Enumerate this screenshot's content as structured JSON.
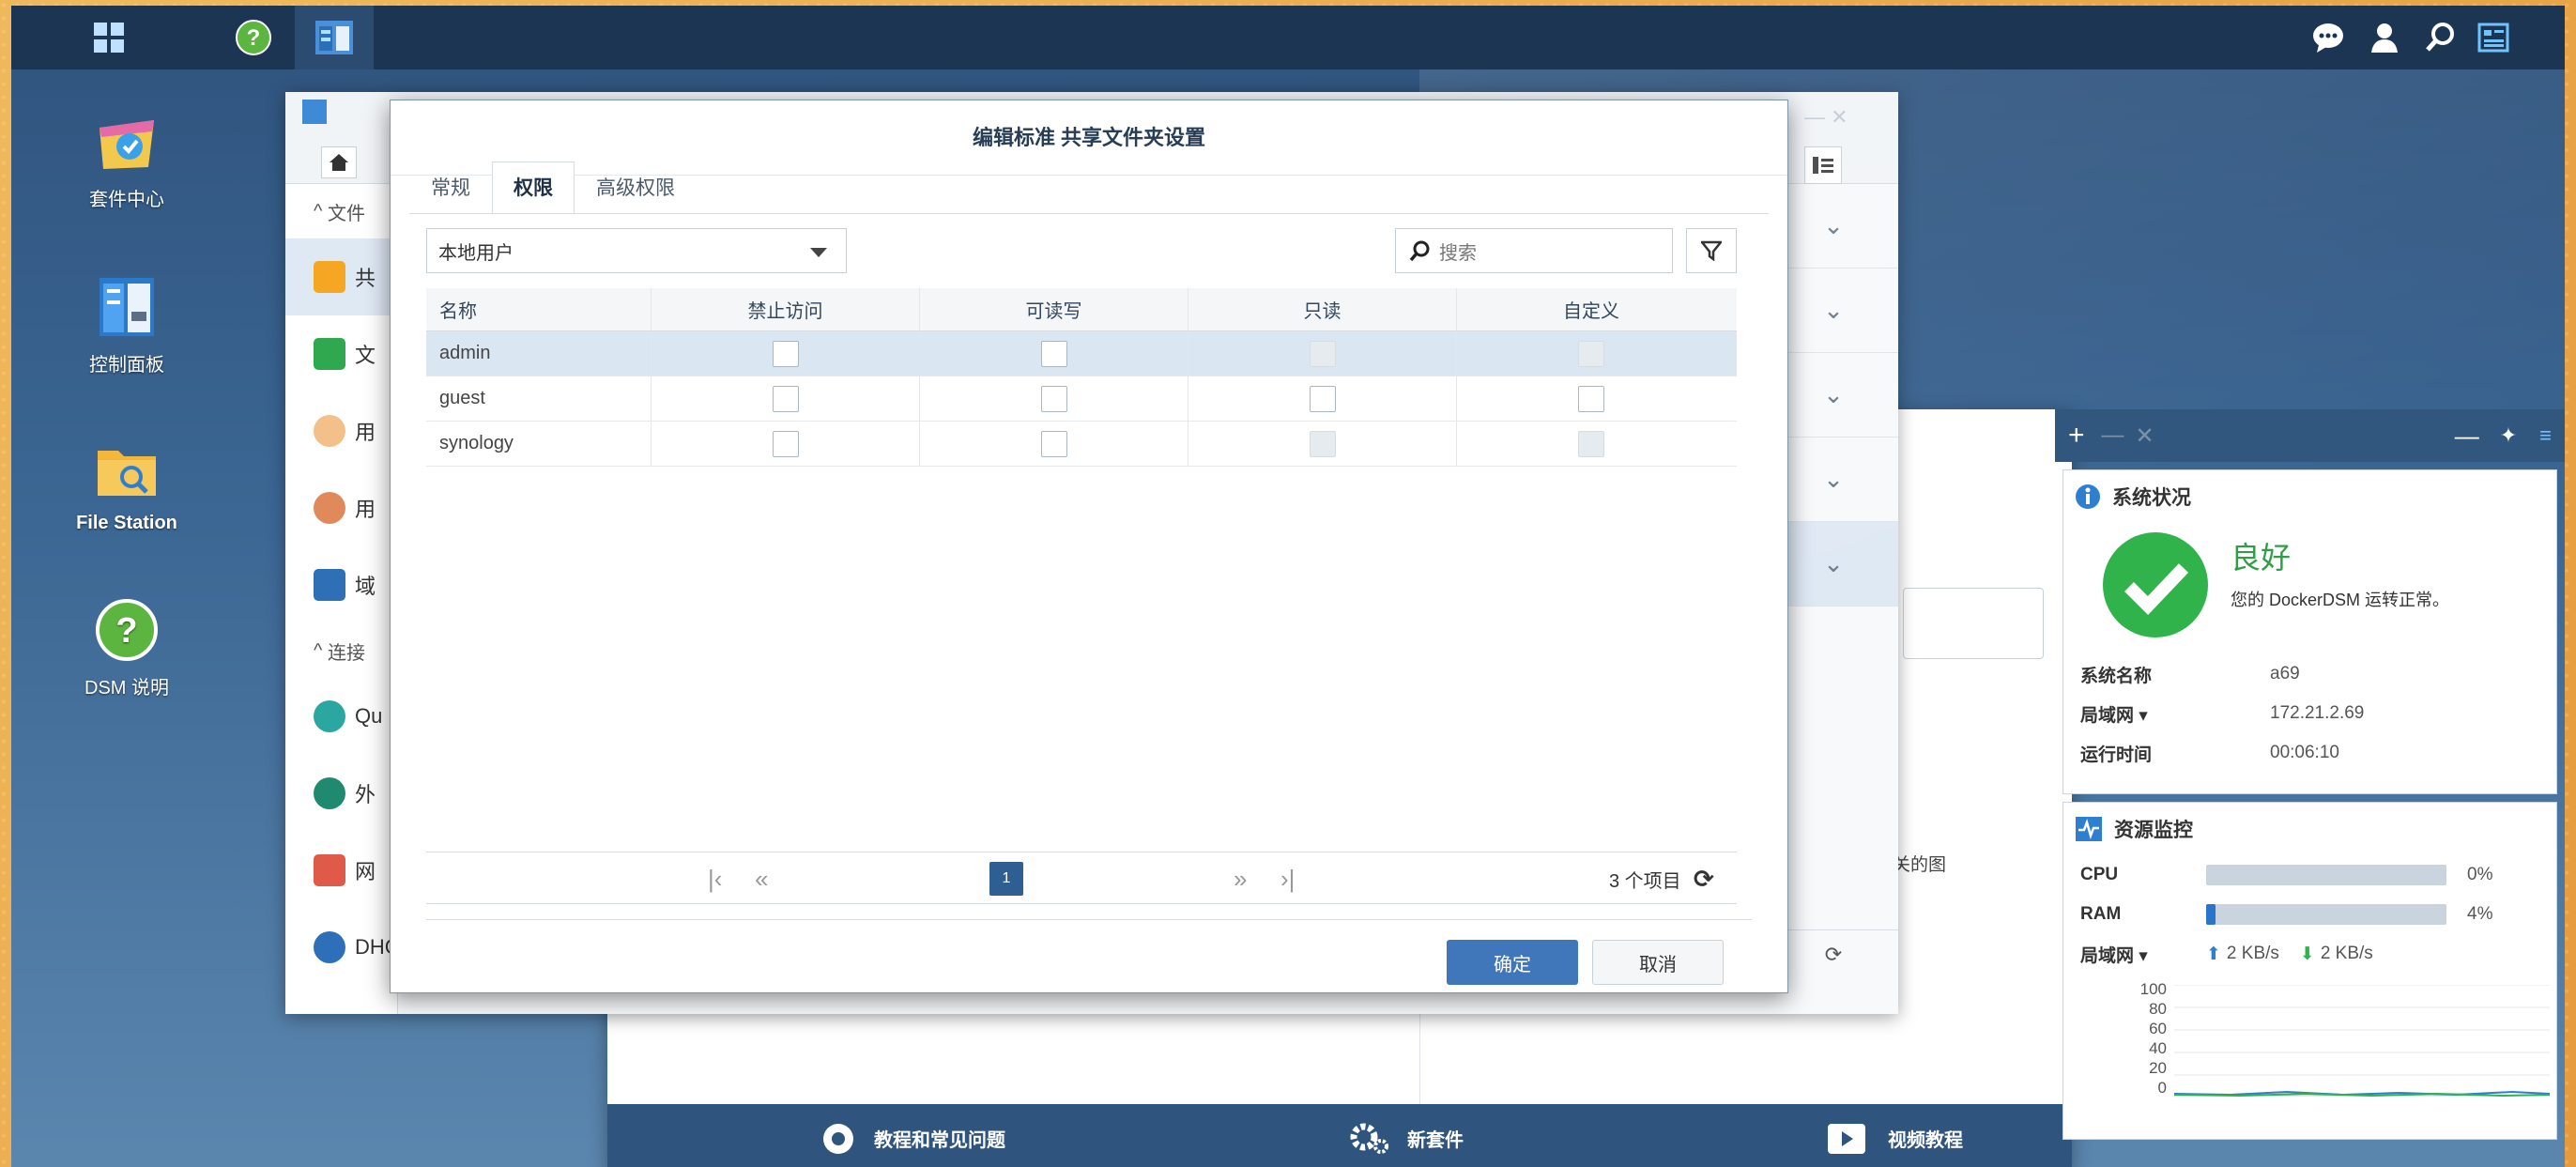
{
  "taskbar": {
    "icons": [
      "main-menu-icon",
      "help-icon",
      "control-panel-icon"
    ],
    "right_icons": [
      "chat-icon",
      "user-icon",
      "search-icon",
      "widgets-icon"
    ]
  },
  "desktop": {
    "icons": [
      {
        "label": "套件中心"
      },
      {
        "label": "控制面板"
      },
      {
        "label": "File Station"
      },
      {
        "label": "DSM 说明"
      }
    ]
  },
  "control_panel": {
    "sidebar": {
      "section1": "文件",
      "items1": [
        "共",
        "文",
        "用",
        "用",
        "域"
      ],
      "section2": "连接",
      "items2": [
        "Qu",
        "外",
        "网",
        "DHCP Server"
      ]
    }
  },
  "help": {
    "side_text": "相关的图",
    "footer": [
      "教程和常见问题",
      "新套件",
      "视频教程"
    ]
  },
  "dialog": {
    "title": "编辑标准 共享文件夹设置",
    "tabs": [
      "常规",
      "权限",
      "高级权限"
    ],
    "user_type": "本地用户",
    "search_placeholder": "搜索",
    "columns": [
      "名称",
      "禁止访问",
      "可读写",
      "只读",
      "自定义"
    ],
    "rows": [
      {
        "name": "admin",
        "deny": false,
        "rw": false,
        "ro": false,
        "custom": false,
        "ro_disabled": true,
        "custom_disabled": true
      },
      {
        "name": "guest",
        "deny": false,
        "rw": false,
        "ro": false,
        "custom": false,
        "ro_disabled": false,
        "custom_disabled": false
      },
      {
        "name": "synology",
        "deny": false,
        "rw": false,
        "ro": false,
        "custom": false,
        "ro_disabled": true,
        "custom_disabled": true
      }
    ],
    "pager": {
      "page": "1",
      "count": "3 个项目"
    },
    "ok": "确定",
    "cancel": "取消"
  },
  "widgets": {
    "system_status": {
      "title": "系统状况",
      "status": "良好",
      "desc": "您的 DockerDSM 运转正常。",
      "rows": [
        {
          "k": "系统名称",
          "v": "a69"
        },
        {
          "k": "局域网 ▾",
          "v": "172.21.2.69"
        },
        {
          "k": "运行时间",
          "v": "00:06:10"
        }
      ]
    },
    "resource_monitor": {
      "title": "资源监控",
      "cpu_label": "CPU",
      "cpu": "0%",
      "cpu_value": 0,
      "ram_label": "RAM",
      "ram": "4%",
      "ram_value": 4,
      "lan_label": "局域网 ▾",
      "up": "2 KB/s",
      "down": "2 KB/s",
      "chart_ticks": [
        "100",
        "80",
        "60",
        "40",
        "20",
        "0"
      ]
    }
  },
  "colors": {
    "accent": "#3f77ba",
    "ok_green": "#2fb34a",
    "taskbar": "#1c3553"
  }
}
